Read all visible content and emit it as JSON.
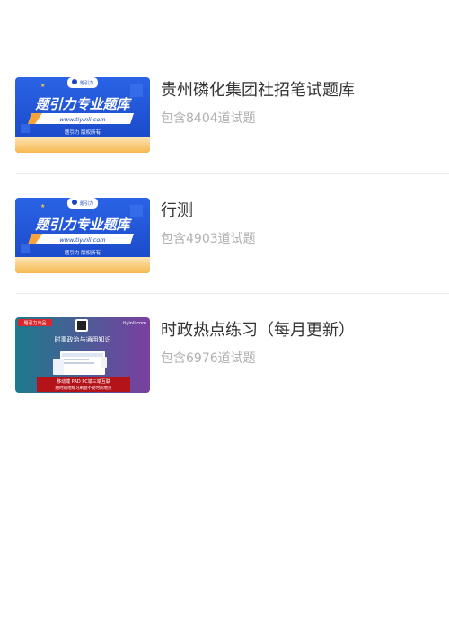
{
  "banks": [
    {
      "title": "贵州磷化集团社招笔试题库",
      "count": "包含8404道试题",
      "thumb_type": "brand",
      "thumb": {
        "headline": "题引力专业题库",
        "url": "www.tiyinli.com",
        "footer": "题引力 版权所有",
        "logo_text": "题引力"
      }
    },
    {
      "title": "行测",
      "count": "包含4903道试题",
      "thumb_type": "brand",
      "thumb": {
        "headline": "题引力专业题库",
        "url": "www.tiyinli.com",
        "footer": "题引力 版权所有",
        "logo_text": "题引力"
      }
    },
    {
      "title": "时政热点练习（每月更新）",
      "count": "包含6976道试题",
      "thumb_type": "promo",
      "thumb": {
        "tag": "题引力出品",
        "site": "tiyinli.com",
        "headline": "时事政治与通用知识",
        "banner_line1": "移动端  PAD  PC端三端互联",
        "banner_line2": "随时随地练习刷题不受时间地点"
      }
    }
  ],
  "colors": {
    "brand_blue": "#1f55d6",
    "brand_orange": "#f7a23a",
    "title_text": "#333333",
    "count_text": "#b0b0b0",
    "divider": "#ebebeb",
    "promo_teal": "#1d7a8c",
    "promo_purple": "#7a3fa0",
    "promo_red": "#b5131a"
  }
}
